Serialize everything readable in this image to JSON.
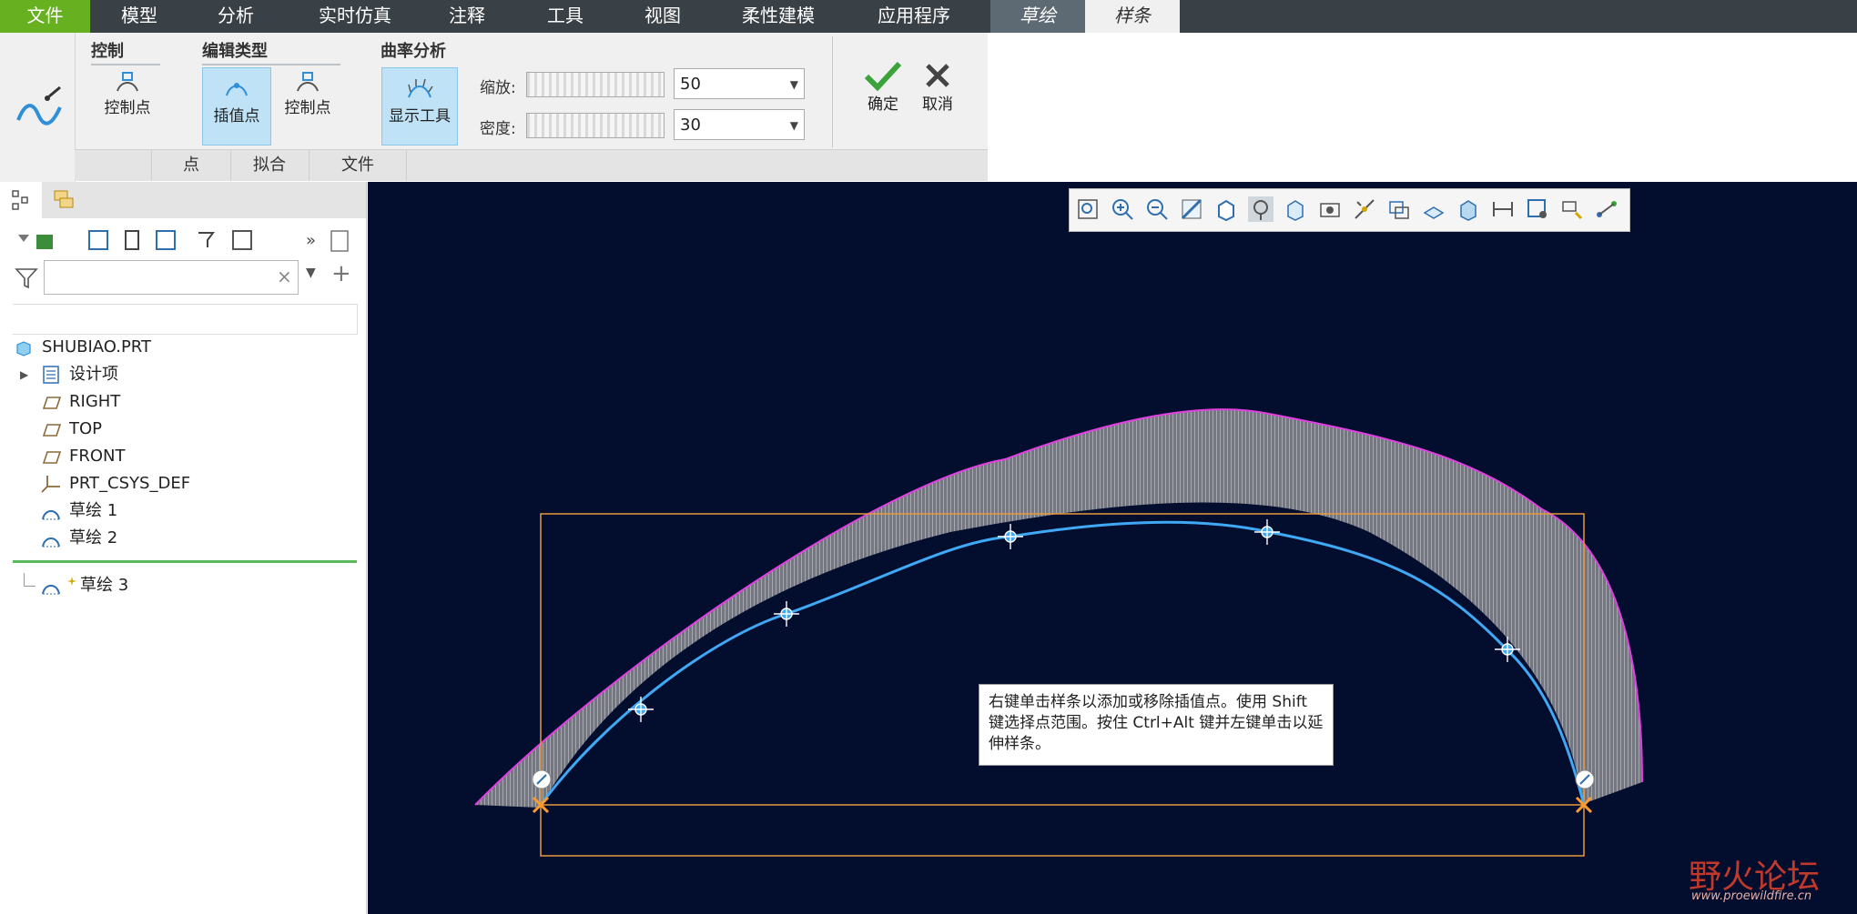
{
  "menu": {
    "items": [
      "文件",
      "模型",
      "分析",
      "实时仿真",
      "注释",
      "工具",
      "视图",
      "柔性建模",
      "应用程序",
      "草绘",
      "样条"
    ]
  },
  "ribbon": {
    "control": {
      "title": "控制",
      "control_point": "控制点"
    },
    "edit_type": {
      "title": "编辑类型",
      "interp_point": "插值点",
      "control_point": "控制点"
    },
    "curvature": {
      "title": "曲率分析",
      "show_tools": "显示工具",
      "scale_label": "缩放:",
      "scale_value": "50",
      "density_label": "密度:",
      "density_value": "30"
    },
    "ok": "确定",
    "cancel": "取消",
    "tabs": [
      "点",
      "拟合",
      "文件"
    ]
  },
  "tree": {
    "search_placeholder": "",
    "items": [
      {
        "label": "SHUBIAO.PRT",
        "icon": "part-icon"
      },
      {
        "label": "设计项",
        "icon": "design-items-icon"
      },
      {
        "label": "RIGHT",
        "icon": "datum-plane-icon"
      },
      {
        "label": "TOP",
        "icon": "datum-plane-icon"
      },
      {
        "label": "FRONT",
        "icon": "datum-plane-icon"
      },
      {
        "label": "PRT_CSYS_DEF",
        "icon": "csys-icon"
      },
      {
        "label": "草绘 1",
        "icon": "sketch-icon"
      },
      {
        "label": "草绘 2",
        "icon": "sketch-icon"
      },
      {
        "label": "草绘 3",
        "icon": "sketch-icon"
      }
    ]
  },
  "graphics": {
    "tooltip": "右键单击样条以添加或移除插值点。使用 Shift 键选择点范围。按住 Ctrl+Alt 键并左键单击以延伸样条。",
    "watermark_name": "野火论坛",
    "watermark_url": "www.proewildfire.cn"
  },
  "colors": {
    "menubar": "#3a4146",
    "file_green": "#67b01f",
    "graphics_bg": "#030d2e",
    "spline_blue": "#3fa9f5",
    "curvature_magenta": "#e040e0",
    "box_orange": "#e89a3c"
  }
}
